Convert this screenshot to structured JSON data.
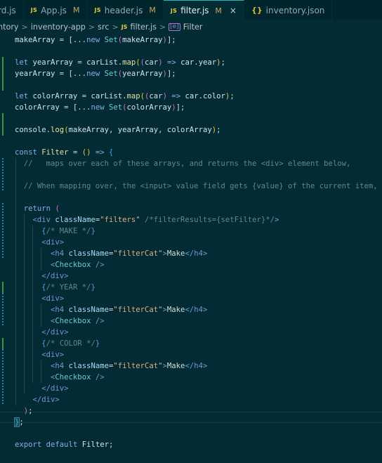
{
  "tabs": [
    {
      "label": "rd.js",
      "badge": "",
      "modified": "",
      "active": false
    },
    {
      "label": "App.js",
      "badge": "JS",
      "modified": "M",
      "active": false
    },
    {
      "label": "header.js",
      "badge": "JS",
      "modified": "M",
      "active": false
    },
    {
      "label": "filter.js",
      "badge": "JS",
      "modified": "M",
      "active": true,
      "close": "×"
    },
    {
      "label": "inventory.json",
      "badge": "{}",
      "modified": "",
      "active": false
    }
  ],
  "breadcrumb": {
    "items": [
      "ntory",
      "inventory-app",
      "src",
      "filter.js",
      "Filter"
    ],
    "separator": ">",
    "file_badge": "JS",
    "symbol_badge": "[e]"
  },
  "code": [
    [
      [
        "id",
        "makeArray"
      ],
      [
        "pn",
        " = ["
      ],
      [
        "pn",
        "..."
      ],
      [
        "kw",
        "new"
      ],
      [
        "pn",
        " "
      ],
      [
        "cp",
        "Set"
      ],
      [
        "brp",
        "("
      ],
      [
        "id",
        "makeArray"
      ],
      [
        "brp",
        ")"
      ],
      [
        "pn",
        "];"
      ]
    ],
    [],
    [
      [
        "kw",
        "let"
      ],
      [
        "pn",
        " "
      ],
      [
        "id",
        "yearArray"
      ],
      [
        "pn",
        " = "
      ],
      [
        "id",
        "carList"
      ],
      [
        "pn",
        "."
      ],
      [
        "fn",
        "map"
      ],
      [
        "br",
        "("
      ],
      [
        "brp",
        "("
      ],
      [
        "id",
        "car"
      ],
      [
        "brp",
        ")"
      ],
      [
        "pn",
        " "
      ],
      [
        "kw",
        "=>"
      ],
      [
        "pn",
        " "
      ],
      [
        "id",
        "car"
      ],
      [
        "pn",
        "."
      ],
      [
        "id",
        "year"
      ],
      [
        "br",
        ")"
      ],
      [
        "pn",
        ";"
      ]
    ],
    [
      [
        "id",
        "yearArray"
      ],
      [
        "pn",
        " = [..."
      ],
      [
        "kw",
        "new"
      ],
      [
        "pn",
        " "
      ],
      [
        "cp",
        "Set"
      ],
      [
        "brp",
        "("
      ],
      [
        "id",
        "yearArray"
      ],
      [
        "brp",
        ")"
      ],
      [
        "pn",
        "];"
      ]
    ],
    [],
    [
      [
        "kw",
        "let"
      ],
      [
        "pn",
        " "
      ],
      [
        "id",
        "colorArray"
      ],
      [
        "pn",
        " = "
      ],
      [
        "id",
        "carList"
      ],
      [
        "pn",
        "."
      ],
      [
        "fn",
        "map"
      ],
      [
        "br",
        "("
      ],
      [
        "brp",
        "("
      ],
      [
        "id",
        "car"
      ],
      [
        "brp",
        ")"
      ],
      [
        "pn",
        " "
      ],
      [
        "kw",
        "=>"
      ],
      [
        "pn",
        " "
      ],
      [
        "id",
        "car"
      ],
      [
        "pn",
        "."
      ],
      [
        "id",
        "color"
      ],
      [
        "br",
        ")"
      ],
      [
        "pn",
        ";"
      ]
    ],
    [
      [
        "id",
        "colorArray"
      ],
      [
        "pn",
        " = [..."
      ],
      [
        "kw",
        "new"
      ],
      [
        "pn",
        " "
      ],
      [
        "cp",
        "Set"
      ],
      [
        "brp",
        "("
      ],
      [
        "id",
        "colorArray"
      ],
      [
        "brp",
        ")"
      ],
      [
        "pn",
        "];"
      ]
    ],
    [],
    [
      [
        "id",
        "console"
      ],
      [
        "pn",
        "."
      ],
      [
        "fn",
        "log"
      ],
      [
        "br",
        "("
      ],
      [
        "id",
        "makeArray"
      ],
      [
        "pn",
        ", "
      ],
      [
        "id",
        "yearArray"
      ],
      [
        "pn",
        ", "
      ],
      [
        "id",
        "colorArray"
      ],
      [
        "br",
        ")"
      ],
      [
        "pn",
        ";"
      ]
    ],
    [],
    [
      [
        "kw",
        "const"
      ],
      [
        "pn",
        " "
      ],
      [
        "fn",
        "Filter"
      ],
      [
        "pn",
        " = "
      ],
      [
        "br",
        "()"
      ],
      [
        "pn",
        " "
      ],
      [
        "kw",
        "=>"
      ],
      [
        "pn",
        " "
      ],
      [
        "brb",
        "{"
      ]
    ],
    [
      [
        "cm",
        "  //   maps over each of these arrays, and returns the <div> element below,"
      ]
    ],
    [],
    [
      [
        "cm",
        "  // When mapping over, the <input> value field gets {value} of the current item,"
      ]
    ],
    [],
    [
      [
        "pn",
        "  "
      ],
      [
        "kw",
        "return"
      ],
      [
        "pn",
        " "
      ],
      [
        "brp",
        "("
      ]
    ],
    [
      [
        "pn",
        "    "
      ],
      [
        "tg",
        "<div"
      ],
      [
        "pn",
        " "
      ],
      [
        "at",
        "className"
      ],
      [
        "pn",
        "="
      ],
      [
        "str",
        "\"filters\""
      ],
      [
        "pn",
        " "
      ],
      [
        "cm",
        "/*filterResults={setFilter}*/"
      ],
      [
        "tg",
        ">"
      ]
    ],
    [
      [
        "pn",
        "      "
      ],
      [
        "brb",
        "{"
      ],
      [
        "cm",
        "/* MAKE */"
      ],
      [
        "brb",
        "}"
      ]
    ],
    [
      [
        "pn",
        "      "
      ],
      [
        "tg",
        "<div>"
      ]
    ],
    [
      [
        "pn",
        "        "
      ],
      [
        "tg",
        "<h4"
      ],
      [
        "pn",
        " "
      ],
      [
        "at",
        "className"
      ],
      [
        "pn",
        "="
      ],
      [
        "str",
        "\"filterCat\""
      ],
      [
        "tg",
        ">"
      ],
      [
        "pn",
        "Make"
      ],
      [
        "tg",
        "</h4>"
      ]
    ],
    [
      [
        "pn",
        "        "
      ],
      [
        "tg",
        "<"
      ],
      [
        "cp",
        "Checkbox"
      ],
      [
        "pn",
        " "
      ],
      [
        "tg",
        "/>"
      ]
    ],
    [
      [
        "pn",
        "      "
      ],
      [
        "tg",
        "</div>"
      ]
    ],
    [
      [
        "pn",
        "      "
      ],
      [
        "brb",
        "{"
      ],
      [
        "cm",
        "/* YEAR */"
      ],
      [
        "brb",
        "}"
      ]
    ],
    [
      [
        "pn",
        "      "
      ],
      [
        "tg",
        "<div>"
      ]
    ],
    [
      [
        "pn",
        "        "
      ],
      [
        "tg",
        "<h4"
      ],
      [
        "pn",
        " "
      ],
      [
        "at",
        "className"
      ],
      [
        "pn",
        "="
      ],
      [
        "str",
        "\"filterCat\""
      ],
      [
        "tg",
        ">"
      ],
      [
        "pn",
        "Make"
      ],
      [
        "tg",
        "</h4>"
      ]
    ],
    [
      [
        "pn",
        "        "
      ],
      [
        "tg",
        "<"
      ],
      [
        "cp",
        "Checkbox"
      ],
      [
        "pn",
        " "
      ],
      [
        "tg",
        "/>"
      ]
    ],
    [
      [
        "pn",
        "      "
      ],
      [
        "tg",
        "</div>"
      ]
    ],
    [
      [
        "pn",
        "      "
      ],
      [
        "brb",
        "{"
      ],
      [
        "cm",
        "/* COLOR */"
      ],
      [
        "brb",
        "}"
      ]
    ],
    [
      [
        "pn",
        "      "
      ],
      [
        "tg",
        "<div>"
      ]
    ],
    [
      [
        "pn",
        "        "
      ],
      [
        "tg",
        "<h4"
      ],
      [
        "pn",
        " "
      ],
      [
        "at",
        "className"
      ],
      [
        "pn",
        "="
      ],
      [
        "str",
        "\"filterCat\""
      ],
      [
        "tg",
        ">"
      ],
      [
        "pn",
        "Make"
      ],
      [
        "tg",
        "</h4>"
      ]
    ],
    [
      [
        "pn",
        "        "
      ],
      [
        "tg",
        "<"
      ],
      [
        "cp",
        "Checkbox"
      ],
      [
        "pn",
        " "
      ],
      [
        "tg",
        "/>"
      ]
    ],
    [
      [
        "pn",
        "      "
      ],
      [
        "tg",
        "</div>"
      ]
    ],
    [
      [
        "pn",
        "    "
      ],
      [
        "tg",
        "</div>"
      ]
    ],
    [
      [
        "pn",
        "  "
      ],
      [
        "brp",
        ")"
      ],
      [
        "pn",
        ";"
      ]
    ],
    [
      [
        "brb",
        "}"
      ],
      [
        "pn",
        ";"
      ]
    ],
    [],
    [
      [
        "kw",
        "export"
      ],
      [
        "pn",
        " "
      ],
      [
        "kw",
        "default"
      ],
      [
        "pn",
        " "
      ],
      [
        "id",
        "Filter"
      ],
      [
        "pn",
        ";"
      ]
    ]
  ]
}
